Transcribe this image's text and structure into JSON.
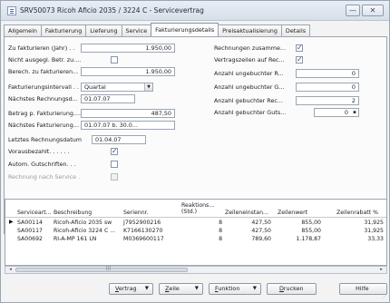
{
  "window": {
    "title": "SRV50073 Ricoh Aficio 2035 / 3224 C - Servicevertrag",
    "minimize_glyph": "—",
    "close_glyph": "✕"
  },
  "tabs": [
    {
      "label": "Allgemein",
      "active": false
    },
    {
      "label": "Fakturierung",
      "active": false
    },
    {
      "label": "Lieferung",
      "active": false
    },
    {
      "label": "Service",
      "active": false
    },
    {
      "label": "Fakturierungsdetails",
      "active": true
    },
    {
      "label": "Preisaktualisierung",
      "active": false
    },
    {
      "label": "Details",
      "active": false
    }
  ],
  "left_fields": {
    "zu_fakturieren": {
      "label": "Zu fakturieren (Jahr) . .",
      "value": "1.950,00"
    },
    "nicht_ausgegl": {
      "label": "Nicht ausgegl. Betr. zu....",
      "checked": false
    },
    "berech": {
      "label": "Berech. zu fakturieren...",
      "value": "1.950,00"
    },
    "intervall": {
      "label": "Fakturierungsintervall . .",
      "value": "Quartal",
      "dropdown_glyph": "▼"
    },
    "naechstes_rechnungsd": {
      "label": "Nächstes Rechnungsd...",
      "value": "01.07.07"
    },
    "betrag_p": {
      "label": "Betrag p. Fakturierung....",
      "value": "487,50"
    },
    "naechste_fakt": {
      "label": "Nächstes Fakturierung...",
      "value": "01.07.07 b. 30.0..."
    },
    "letztes": {
      "label": "Letztes Rechnungsdatum",
      "value": "01.04.07"
    },
    "vorausbezahlt": {
      "label": "Vorausbezahlt. . . . . .",
      "checked": true
    },
    "autom_gutschriften": {
      "label": "Autom. Gutschriften. . .",
      "checked": false
    },
    "rechnung_nach_service": {
      "label": "Rechnung nach Service .",
      "checked": false
    }
  },
  "right_fields": {
    "rechnungen_zusamme": {
      "label": "Rechnungen zusamme...",
      "checked": true
    },
    "vertragszeilen": {
      "label": "Vertragszeilen auf Rec...",
      "checked": true
    },
    "ungebuchter_r": {
      "label": "Anzahl ungebuchter R...",
      "value": "0"
    },
    "ungebuchter_g": {
      "label": "Anzahl ungebuchter G...",
      "value": "0"
    },
    "gebuchter_rec": {
      "label": "Anzahl gebuchter Rec...",
      "value": "2"
    },
    "gebuchter_guts": {
      "label": "Anzahl gebuchter Guts...",
      "value": "0"
    }
  },
  "grid": {
    "headers": [
      "Serviceart...",
      "Beschreibung",
      "Seriennr.",
      "Reaktions... (Std.)",
      "Zeileneinstan...",
      "Zeilenwert",
      "Zeilenrabatt %"
    ],
    "header_line1_reaktions": "Reaktions...",
    "header_line2_reaktions": "(Std.)",
    "rows": [
      {
        "selected": true,
        "serviceart": "SA00114",
        "beschreibung": "Ricoh-Aficio 2035 sw",
        "seriennr": "J7952900216",
        "reaktion": "8",
        "zeileneinstand": "427,50",
        "zeilenwert": "855,00",
        "rabatt": "31,925"
      },
      {
        "selected": false,
        "serviceart": "SA00117",
        "beschreibung": "Ricoh-Aficio 3224 C ...",
        "seriennr": "K7166130270",
        "reaktion": "8",
        "zeileneinstand": "427,50",
        "zeilenwert": "855,00",
        "rabatt": "31,925"
      },
      {
        "selected": false,
        "serviceart": "SA00692",
        "beschreibung": "RI-A-MP 161 LN",
        "seriennr": "M0369600117",
        "reaktion": "8",
        "zeileneinstand": "789,60",
        "zeilenwert": "1.178,87",
        "rabatt": "33,33"
      }
    ],
    "row_indicator": "▶"
  },
  "scrollbar": {
    "left_arrow": "◂",
    "right_arrow": "▸",
    "grip": "|||"
  },
  "buttons": {
    "vertrag": {
      "label_u": "V",
      "label_rest": "ertrag",
      "arrow": "▼"
    },
    "zeile": {
      "label_u": "Z",
      "label_rest": "eile",
      "arrow": "▼"
    },
    "funktion": {
      "label_u": "F",
      "label_rest": "unktion",
      "arrow": "▼"
    },
    "drucken": {
      "label_u": "D",
      "label_rest": "rucken"
    },
    "hilfe": {
      "label": "Hilfe"
    }
  }
}
